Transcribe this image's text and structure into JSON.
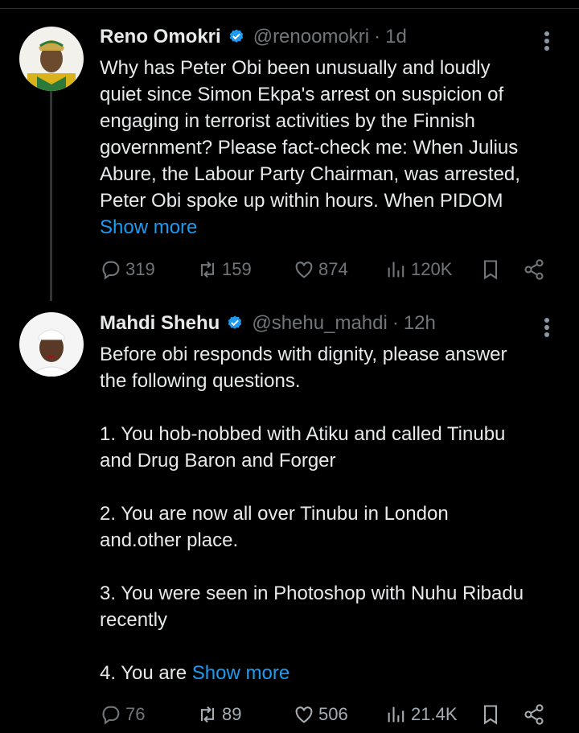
{
  "tweets": [
    {
      "name": "Reno Omokri",
      "handle": "@renoomokri",
      "time": "1d",
      "body_lines": [
        "Why has Peter Obi been unusually and loudly",
        "quiet since Simon Ekpa's arrest on suspicion of",
        "engaging in terrorist activities by the Finnish",
        "government? Please fact-check me: When Julius",
        "Abure, the Labour Party Chairman, was arrested,",
        "Peter Obi spoke up within hours. When PIDOM"
      ],
      "show_more": "Show more",
      "replies": "319",
      "reposts": "159",
      "likes": "874",
      "views": "120K"
    },
    {
      "name": "Mahdi Shehu",
      "handle": "@shehu_mahdi",
      "time": "12h",
      "body_lines": [
        "Before obi responds with dignity, please answer",
        "the following questions.",
        "",
        "1. You hob-nobbed  with Atiku and called Tinubu",
        "and Drug Baron and Forger",
        "",
        "2. You are now all over Tinubu in London",
        "and.other place.",
        "",
        "3. You were seen in Photoshop with Nuhu Ribadu",
        "recently",
        ""
      ],
      "last_line_prefix": "4. You are ",
      "show_more": "Show more",
      "replies": "76",
      "reposts": "89",
      "likes": "506",
      "views": "21.4K"
    }
  ],
  "icons": [
    "verified-badge-icon",
    "more-options-icon",
    "reply-icon",
    "repost-icon",
    "like-icon",
    "views-icon",
    "bookmark-icon",
    "share-icon"
  ],
  "colors": {
    "background": "#000000",
    "text": "#e7e9ea",
    "muted": "#71767b",
    "link": "#1d9bf0",
    "verified": "#1d9bf0"
  }
}
